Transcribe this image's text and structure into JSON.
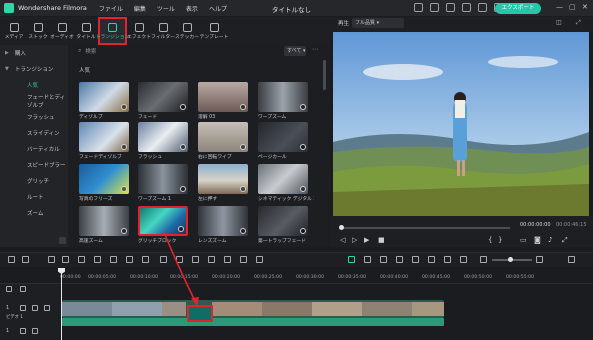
{
  "app": {
    "name": "Wondershare Filmora",
    "menu": [
      "ファイル",
      "編集",
      "ツール",
      "表示",
      "ヘルプ"
    ],
    "title": "タイトルなし",
    "export_label": "エクスポート",
    "accent_color": "#2fd6a8",
    "highlight_color": "#e1242c"
  },
  "media_toolbar": {
    "items": [
      {
        "label": "メディア",
        "icon": "media-icon"
      },
      {
        "label": "ストック",
        "icon": "stock-icon"
      },
      {
        "label": "オーディオ",
        "icon": "audio-icon"
      },
      {
        "label": "タイトル",
        "icon": "title-icon"
      },
      {
        "label": "トランジション",
        "icon": "transition-icon",
        "active": true
      },
      {
        "label": "エフェクト",
        "icon": "effects-icon"
      },
      {
        "label": "フィルター",
        "icon": "filter-icon"
      },
      {
        "label": "ステッカー",
        "icon": "sticker-icon"
      },
      {
        "label": "テンプレート",
        "icon": "template-icon"
      }
    ]
  },
  "left_panel": {
    "items": [
      {
        "label": "購入",
        "level": 0
      },
      {
        "label": "トランジション",
        "level": 0
      },
      {
        "label": "人気",
        "level": 1,
        "active": true
      },
      {
        "label": "フェードとディゾルブ",
        "level": 1
      },
      {
        "label": "フラッシュ",
        "level": 1
      },
      {
        "label": "スライディン",
        "level": 1
      },
      {
        "label": "バーティカル",
        "level": 1
      },
      {
        "label": "スピードブラー",
        "level": 1
      },
      {
        "label": "グリッチ",
        "level": 1
      },
      {
        "label": "ルート",
        "level": 1
      },
      {
        "label": "ズーム",
        "level": 1
      }
    ]
  },
  "grid": {
    "search_placeholder": "検索",
    "filter_label": "すべて",
    "section_title": "人気",
    "items": [
      {
        "label": "ディゾルブ"
      },
      {
        "label": "フェード"
      },
      {
        "label": "溶解 03"
      },
      {
        "label": "ワープズーム"
      },
      {
        "label": "フェードディゾルブ"
      },
      {
        "label": "フラッシュ"
      },
      {
        "label": "右に回転ワイプ"
      },
      {
        "label": "ページカール"
      },
      {
        "label": "写真のフリーズ"
      },
      {
        "label": "ワープズーム 1"
      },
      {
        "label": "左に押す"
      },
      {
        "label": "シネマティック デジタル 3"
      },
      {
        "label": "高速ズーム"
      },
      {
        "label": "グリッチブロック"
      },
      {
        "label": "レンズズーム"
      },
      {
        "label": "第一トラップフェード"
      }
    ]
  },
  "player": {
    "label": "再生",
    "quality": "フル品質",
    "current_time": "00:00:00:00",
    "total_time": "00:00:46:15"
  },
  "timeline": {
    "ruler_ticks": [
      "00:00:00",
      "00:00:05:00",
      "00:00:10:00",
      "00:00:15:00",
      "00:00:20:00",
      "00:00:25:00",
      "00:00:30:00",
      "00:00:35:00",
      "00:00:40:00",
      "00:00:45:00",
      "00:00:50:00",
      "00:00:55:00"
    ],
    "video_track_label": "1",
    "video_track_name": "ビデオ 1",
    "audio_track_label": "1"
  }
}
